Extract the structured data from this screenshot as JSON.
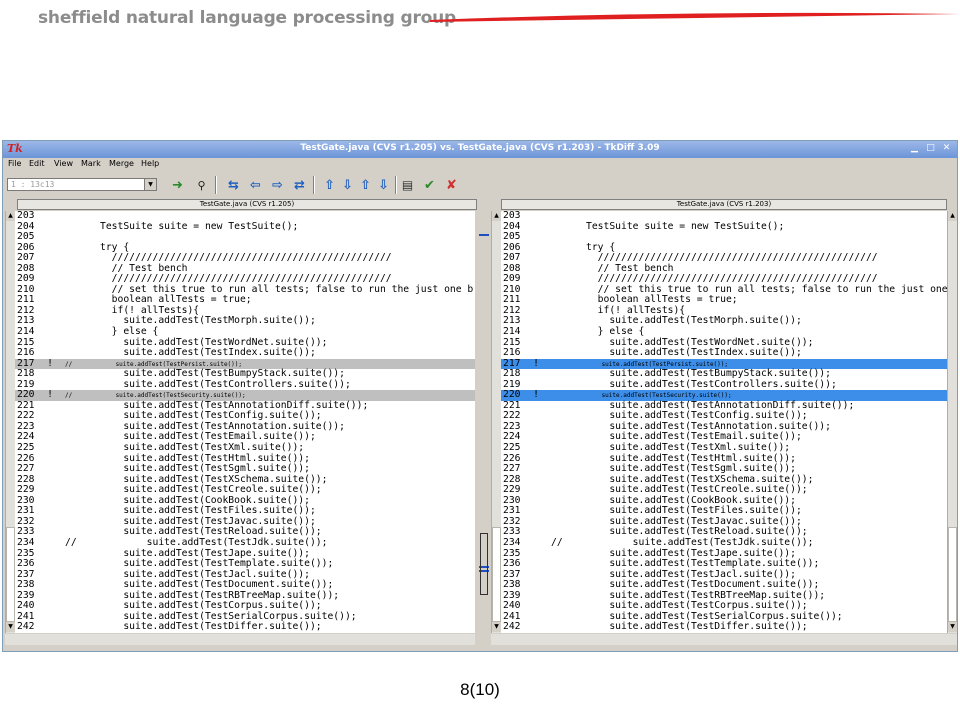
{
  "slide": {
    "brand": "sheffield natural language processing group",
    "page_number": "8(10)"
  },
  "window": {
    "app_icon_text": "Tk",
    "title": "TestGate.java (CVS r1.205) vs. TestGate.java (CVS r1.203) - TkDiff 3.09",
    "menu": [
      "File",
      "Edit",
      "View",
      "Mark",
      "Merge",
      "Help"
    ],
    "combo_value": "1  : 13c13",
    "left_label": "TestGate.java (CVS r1.205)",
    "right_label": "TestGate.java (CVS r1.203)",
    "highlight_colors": {
      "left": "#bfbfbf",
      "right": "#3c8ee8"
    },
    "toolbar_icons": [
      "go-icon",
      "find-icon",
      "sep",
      "center-diff-icon",
      "first-diff-icon",
      "prev-diff-icon",
      "next-diff-icon",
      "sep",
      "merge-up-icon",
      "merge-down-icon",
      "merge-choose-up-icon",
      "merge-choose-down-icon",
      "sep",
      "merge-preview-icon",
      "accept-icon",
      "reject-icon"
    ]
  },
  "code": {
    "left": [
      {
        "n": "203",
        "m": "",
        "t": "",
        "h": ""
      },
      {
        "n": "204",
        "m": "",
        "t": "      TestSuite suite = new TestSuite();",
        "h": ""
      },
      {
        "n": "205",
        "m": "",
        "t": "",
        "h": ""
      },
      {
        "n": "206",
        "m": "",
        "t": "      try {",
        "h": ""
      },
      {
        "n": "207",
        "m": "",
        "t": "        ////////////////////////////////////////////////",
        "h": ""
      },
      {
        "n": "208",
        "m": "",
        "t": "        // Test bench",
        "h": ""
      },
      {
        "n": "209",
        "m": "",
        "t": "        ////////////////////////////////////////////////",
        "h": ""
      },
      {
        "n": "210",
        "m": "",
        "t": "        // set this true to run all tests; false to run the just one b",
        "h": ""
      },
      {
        "n": "211",
        "m": "",
        "t": "        boolean allTests = true;",
        "h": ""
      },
      {
        "n": "212",
        "m": "",
        "t": "        if(! allTests){",
        "h": ""
      },
      {
        "n": "213",
        "m": "",
        "t": "          suite.addTest(TestMorph.suite());",
        "h": ""
      },
      {
        "n": "214",
        "m": "",
        "t": "        } else {",
        "h": ""
      },
      {
        "n": "215",
        "m": "",
        "t": "          suite.addTest(TestWordNet.suite());",
        "h": ""
      },
      {
        "n": "216",
        "m": "",
        "t": "          suite.addTest(TestIndex.suite());",
        "h": ""
      },
      {
        "n": "217",
        "m": "!",
        "t": "//            suite.addTest(TestPersist.suite());",
        "h": "gray"
      },
      {
        "n": "218",
        "m": "",
        "t": "          suite.addTest(TestBumpyStack.suite());",
        "h": ""
      },
      {
        "n": "219",
        "m": "",
        "t": "          suite.addTest(TestControllers.suite());",
        "h": ""
      },
      {
        "n": "220",
        "m": "!",
        "t": "//            suite.addTest(TestSecurity.suite());",
        "h": "gray"
      },
      {
        "n": "221",
        "m": "",
        "t": "          suite.addTest(TestAnnotationDiff.suite());",
        "h": ""
      },
      {
        "n": "222",
        "m": "",
        "t": "          suite.addTest(TestConfig.suite());",
        "h": ""
      },
      {
        "n": "223",
        "m": "",
        "t": "          suite.addTest(TestAnnotation.suite());",
        "h": ""
      },
      {
        "n": "224",
        "m": "",
        "t": "          suite.addTest(TestEmail.suite());",
        "h": ""
      },
      {
        "n": "225",
        "m": "",
        "t": "          suite.addTest(TestXml.suite());",
        "h": ""
      },
      {
        "n": "226",
        "m": "",
        "t": "          suite.addTest(TestHtml.suite());",
        "h": ""
      },
      {
        "n": "227",
        "m": "",
        "t": "          suite.addTest(TestSgml.suite());",
        "h": ""
      },
      {
        "n": "228",
        "m": "",
        "t": "          suite.addTest(TestXSchema.suite());",
        "h": ""
      },
      {
        "n": "229",
        "m": "",
        "t": "          suite.addTest(TestCreole.suite());",
        "h": ""
      },
      {
        "n": "230",
        "m": "",
        "t": "          suite.addTest(CookBook.suite());",
        "h": ""
      },
      {
        "n": "231",
        "m": "",
        "t": "          suite.addTest(TestFiles.suite());",
        "h": ""
      },
      {
        "n": "232",
        "m": "",
        "t": "          suite.addTest(TestJavac.suite());",
        "h": ""
      },
      {
        "n": "233",
        "m": "",
        "t": "          suite.addTest(TestReload.suite());",
        "h": ""
      },
      {
        "n": "234",
        "m": "",
        "t": "//            suite.addTest(TestJdk.suite());",
        "h": ""
      },
      {
        "n": "235",
        "m": "",
        "t": "          suite.addTest(TestJape.suite());",
        "h": ""
      },
      {
        "n": "236",
        "m": "",
        "t": "          suite.addTest(TestTemplate.suite());",
        "h": ""
      },
      {
        "n": "237",
        "m": "",
        "t": "          suite.addTest(TestJacl.suite());",
        "h": ""
      },
      {
        "n": "238",
        "m": "",
        "t": "          suite.addTest(TestDocument.suite());",
        "h": ""
      },
      {
        "n": "239",
        "m": "",
        "t": "          suite.addTest(TestRBTreeMap.suite());",
        "h": ""
      },
      {
        "n": "240",
        "m": "",
        "t": "          suite.addTest(TestCorpus.suite());",
        "h": ""
      },
      {
        "n": "241",
        "m": "",
        "t": "          suite.addTest(TestSerialCorpus.suite());",
        "h": ""
      },
      {
        "n": "242",
        "m": "",
        "t": "          suite.addTest(TestDiffer.suite());",
        "h": ""
      }
    ],
    "right": [
      {
        "n": "203",
        "m": "",
        "t": "",
        "h": ""
      },
      {
        "n": "204",
        "m": "",
        "t": "      TestSuite suite = new TestSuite();",
        "h": ""
      },
      {
        "n": "205",
        "m": "",
        "t": "",
        "h": ""
      },
      {
        "n": "206",
        "m": "",
        "t": "      try {",
        "h": ""
      },
      {
        "n": "207",
        "m": "",
        "t": "        ////////////////////////////////////////////////",
        "h": ""
      },
      {
        "n": "208",
        "m": "",
        "t": "        // Test bench",
        "h": ""
      },
      {
        "n": "209",
        "m": "",
        "t": "        ////////////////////////////////////////////////",
        "h": ""
      },
      {
        "n": "210",
        "m": "",
        "t": "        // set this true to run all tests; false to run the just one b",
        "h": ""
      },
      {
        "n": "211",
        "m": "",
        "t": "        boolean allTests = true;",
        "h": ""
      },
      {
        "n": "212",
        "m": "",
        "t": "        if(! allTests){",
        "h": ""
      },
      {
        "n": "213",
        "m": "",
        "t": "          suite.addTest(TestMorph.suite());",
        "h": ""
      },
      {
        "n": "214",
        "m": "",
        "t": "        } else {",
        "h": ""
      },
      {
        "n": "215",
        "m": "",
        "t": "          suite.addTest(TestWordNet.suite());",
        "h": ""
      },
      {
        "n": "216",
        "m": "",
        "t": "          suite.addTest(TestIndex.suite());",
        "h": ""
      },
      {
        "n": "217",
        "m": "!",
        "t": "              suite.addTest(TestPersist.suite());",
        "h": "blue"
      },
      {
        "n": "218",
        "m": "",
        "t": "          suite.addTest(TestBumpyStack.suite());",
        "h": ""
      },
      {
        "n": "219",
        "m": "",
        "t": "          suite.addTest(TestControllers.suite());",
        "h": ""
      },
      {
        "n": "220",
        "m": "!",
        "t": "              suite.addTest(TestSecurity.suite());",
        "h": "blue"
      },
      {
        "n": "221",
        "m": "",
        "t": "          suite.addTest(TestAnnotationDiff.suite());",
        "h": ""
      },
      {
        "n": "222",
        "m": "",
        "t": "          suite.addTest(TestConfig.suite());",
        "h": ""
      },
      {
        "n": "223",
        "m": "",
        "t": "          suite.addTest(TestAnnotation.suite());",
        "h": ""
      },
      {
        "n": "224",
        "m": "",
        "t": "          suite.addTest(TestEmail.suite());",
        "h": ""
      },
      {
        "n": "225",
        "m": "",
        "t": "          suite.addTest(TestXml.suite());",
        "h": ""
      },
      {
        "n": "226",
        "m": "",
        "t": "          suite.addTest(TestHtml.suite());",
        "h": ""
      },
      {
        "n": "227",
        "m": "",
        "t": "          suite.addTest(TestSgml.suite());",
        "h": ""
      },
      {
        "n": "228",
        "m": "",
        "t": "          suite.addTest(TestXSchema.suite());",
        "h": ""
      },
      {
        "n": "229",
        "m": "",
        "t": "          suite.addTest(TestCreole.suite());",
        "h": ""
      },
      {
        "n": "230",
        "m": "",
        "t": "          suite.addTest(CookBook.suite());",
        "h": ""
      },
      {
        "n": "231",
        "m": "",
        "t": "          suite.addTest(TestFiles.suite());",
        "h": ""
      },
      {
        "n": "232",
        "m": "",
        "t": "          suite.addTest(TestJavac.suite());",
        "h": ""
      },
      {
        "n": "233",
        "m": "",
        "t": "          suite.addTest(TestReload.suite());",
        "h": ""
      },
      {
        "n": "234",
        "m": "",
        "t": "//            suite.addTest(TestJdk.suite());",
        "h": ""
      },
      {
        "n": "235",
        "m": "",
        "t": "          suite.addTest(TestJape.suite());",
        "h": ""
      },
      {
        "n": "236",
        "m": "",
        "t": "          suite.addTest(TestTemplate.suite());",
        "h": ""
      },
      {
        "n": "237",
        "m": "",
        "t": "          suite.addTest(TestJacl.suite());",
        "h": ""
      },
      {
        "n": "238",
        "m": "",
        "t": "          suite.addTest(TestDocument.suite());",
        "h": ""
      },
      {
        "n": "239",
        "m": "",
        "t": "          suite.addTest(TestRBTreeMap.suite());",
        "h": ""
      },
      {
        "n": "240",
        "m": "",
        "t": "          suite.addTest(TestCorpus.suite());",
        "h": ""
      },
      {
        "n": "241",
        "m": "",
        "t": "          suite.addTest(TestSerialCorpus.suite());",
        "h": ""
      },
      {
        "n": "242",
        "m": "",
        "t": "          suite.addTest(TestDiffer.suite());",
        "h": ""
      }
    ]
  }
}
